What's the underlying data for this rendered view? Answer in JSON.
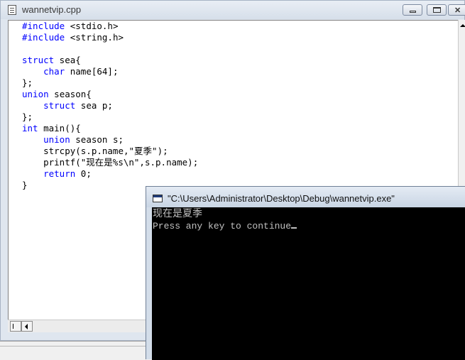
{
  "editor": {
    "title": "wannetvip.cpp",
    "code": [
      {
        "k": "#include",
        "r": " <stdio.h>"
      },
      {
        "k": "#include",
        "r": " <string.h>"
      },
      {
        "k": "",
        "r": ""
      },
      {
        "k": "struct",
        "r": " sea{"
      },
      {
        "k": "    char",
        "r": " name[64];"
      },
      {
        "k": "",
        "r": "};"
      },
      {
        "k": "union",
        "r": " season{"
      },
      {
        "k": "    struct",
        "r": " sea p;"
      },
      {
        "k": "",
        "r": "};"
      },
      {
        "k": "int",
        "r": " main(){"
      },
      {
        "k": "    union",
        "r": " season s;"
      },
      {
        "k": "",
        "r": "    strcpy(s.p.name,\"夏季\");"
      },
      {
        "k": "",
        "r": "    printf(\"现在是%s\\n\",s.p.name);"
      },
      {
        "k": "    return",
        "r": " 0;"
      },
      {
        "k": "",
        "r": "}"
      }
    ]
  },
  "console": {
    "title": "\"C:\\Users\\Administrator\\Desktop\\Debug\\wannetvip.exe\"",
    "output_line1": "现在是夏季",
    "output_line2": "Press any key to continue"
  },
  "colors": {
    "keyword": "#0000ff",
    "console_bg": "#000000",
    "console_text": "#c0c0c0"
  },
  "icons": {
    "editor_file": "document-icon",
    "console": "console-window-icon"
  }
}
